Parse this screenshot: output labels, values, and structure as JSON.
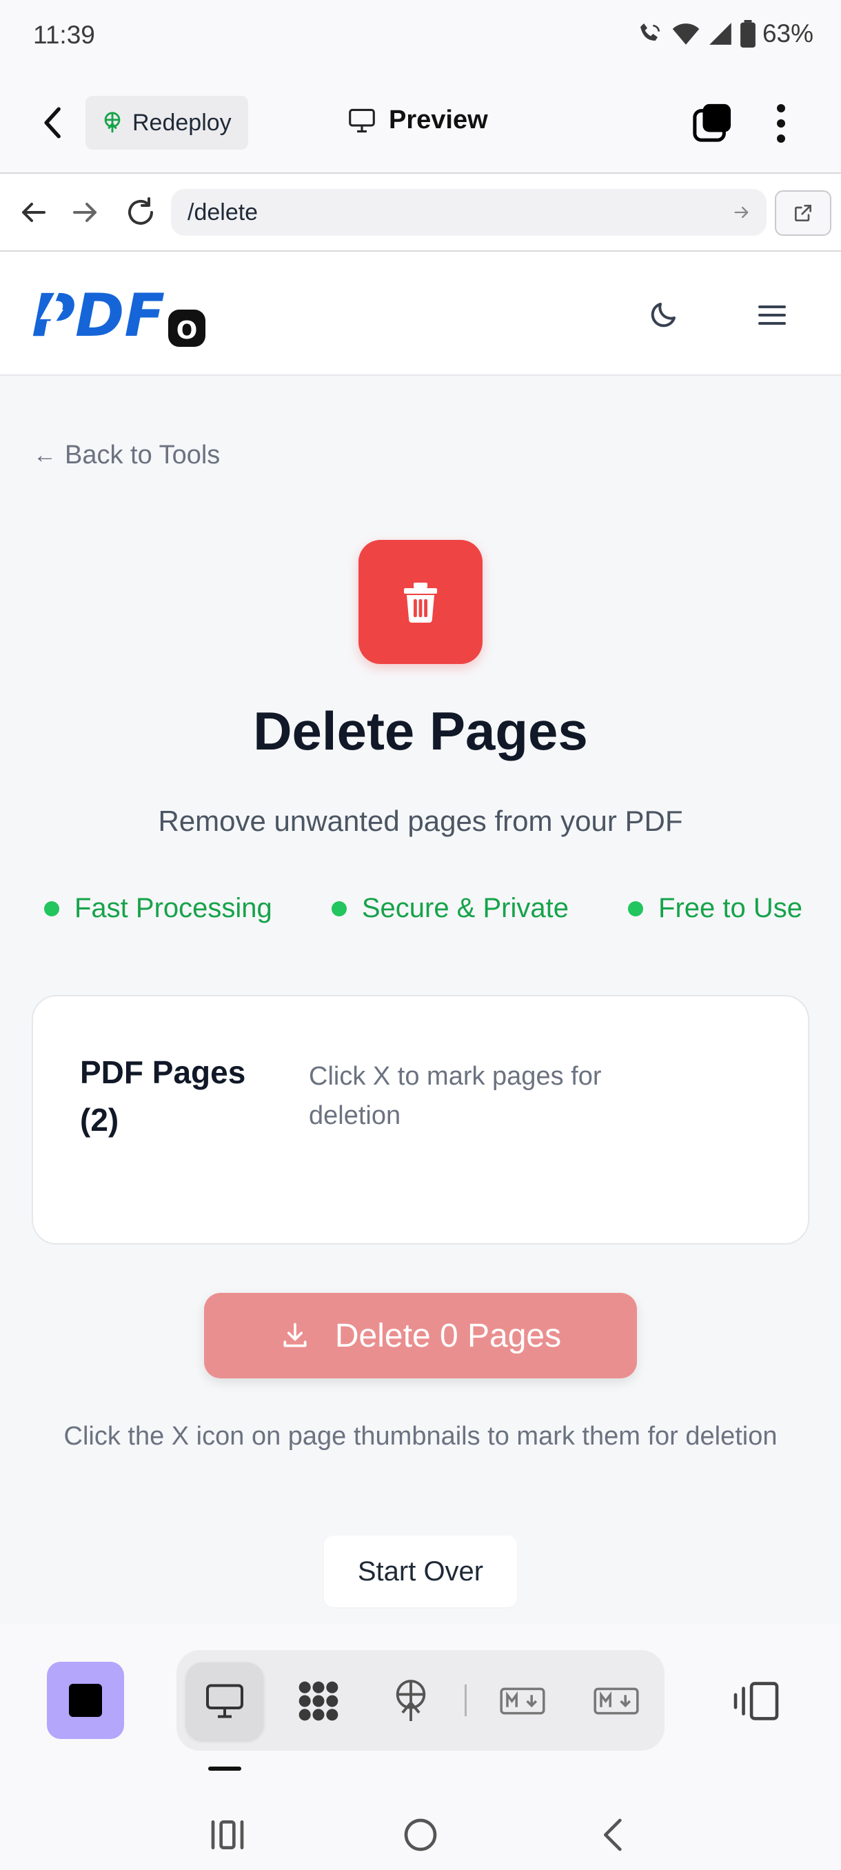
{
  "status_bar": {
    "time": "11:39",
    "battery": "63%"
  },
  "app_bar": {
    "redeploy_label": "Redeploy",
    "preview_label": "Preview"
  },
  "browser": {
    "url": "/delete"
  },
  "site": {
    "logo_text": "PDF",
    "logo_badge": "O"
  },
  "content": {
    "back_link": "Back to Tools",
    "title": "Delete Pages",
    "subtitle": "Remove unwanted pages from your PDF",
    "features": [
      "Fast Processing",
      "Secure & Private",
      "Free to Use"
    ],
    "pages_card": {
      "title": "PDF Pages (2)",
      "hint": "Click X to mark pages for deletion"
    },
    "delete_button": "Delete 0 Pages",
    "help_text": "Click the X icon on page thumbnails to mark them for deletion",
    "start_over": "Start Over"
  },
  "colors": {
    "accent_red": "#ef4444",
    "delete_btn_disabled": "#ea8f8f",
    "feature_green": "#16a34a",
    "logo_blue": "#1565d8",
    "stop_purple": "#b3a6fb"
  },
  "toolbar": {
    "icons": [
      "stop-icon",
      "desktop-preview-icon",
      "components-icon",
      "deploy-icon",
      "markdown-icon",
      "markdown-icon-alt",
      "device-toggle-icon"
    ]
  }
}
